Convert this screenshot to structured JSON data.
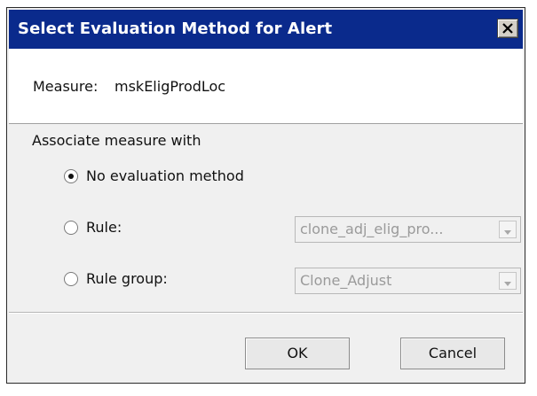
{
  "dialog": {
    "title": "Select Evaluation Method for Alert",
    "close_icon": "close-icon"
  },
  "measure": {
    "label": "Measure:",
    "value": "mskEligProdLoc"
  },
  "associate": {
    "section_label": "Associate measure with",
    "options": [
      {
        "label": "No evaluation method",
        "selected": true
      },
      {
        "label": "Rule:",
        "selected": false,
        "combo_value": "clone_adj_elig_pro...",
        "combo_enabled": false
      },
      {
        "label": "Rule group:",
        "selected": false,
        "combo_value": "Clone_Adjust",
        "combo_enabled": false
      }
    ]
  },
  "buttons": {
    "ok": "OK",
    "cancel": "Cancel"
  },
  "colors": {
    "titlebar": "#0a2a8c",
    "title_text": "#ffffff",
    "dialog_bg": "#f0f0f0",
    "disabled_text": "#9a9a9a"
  }
}
